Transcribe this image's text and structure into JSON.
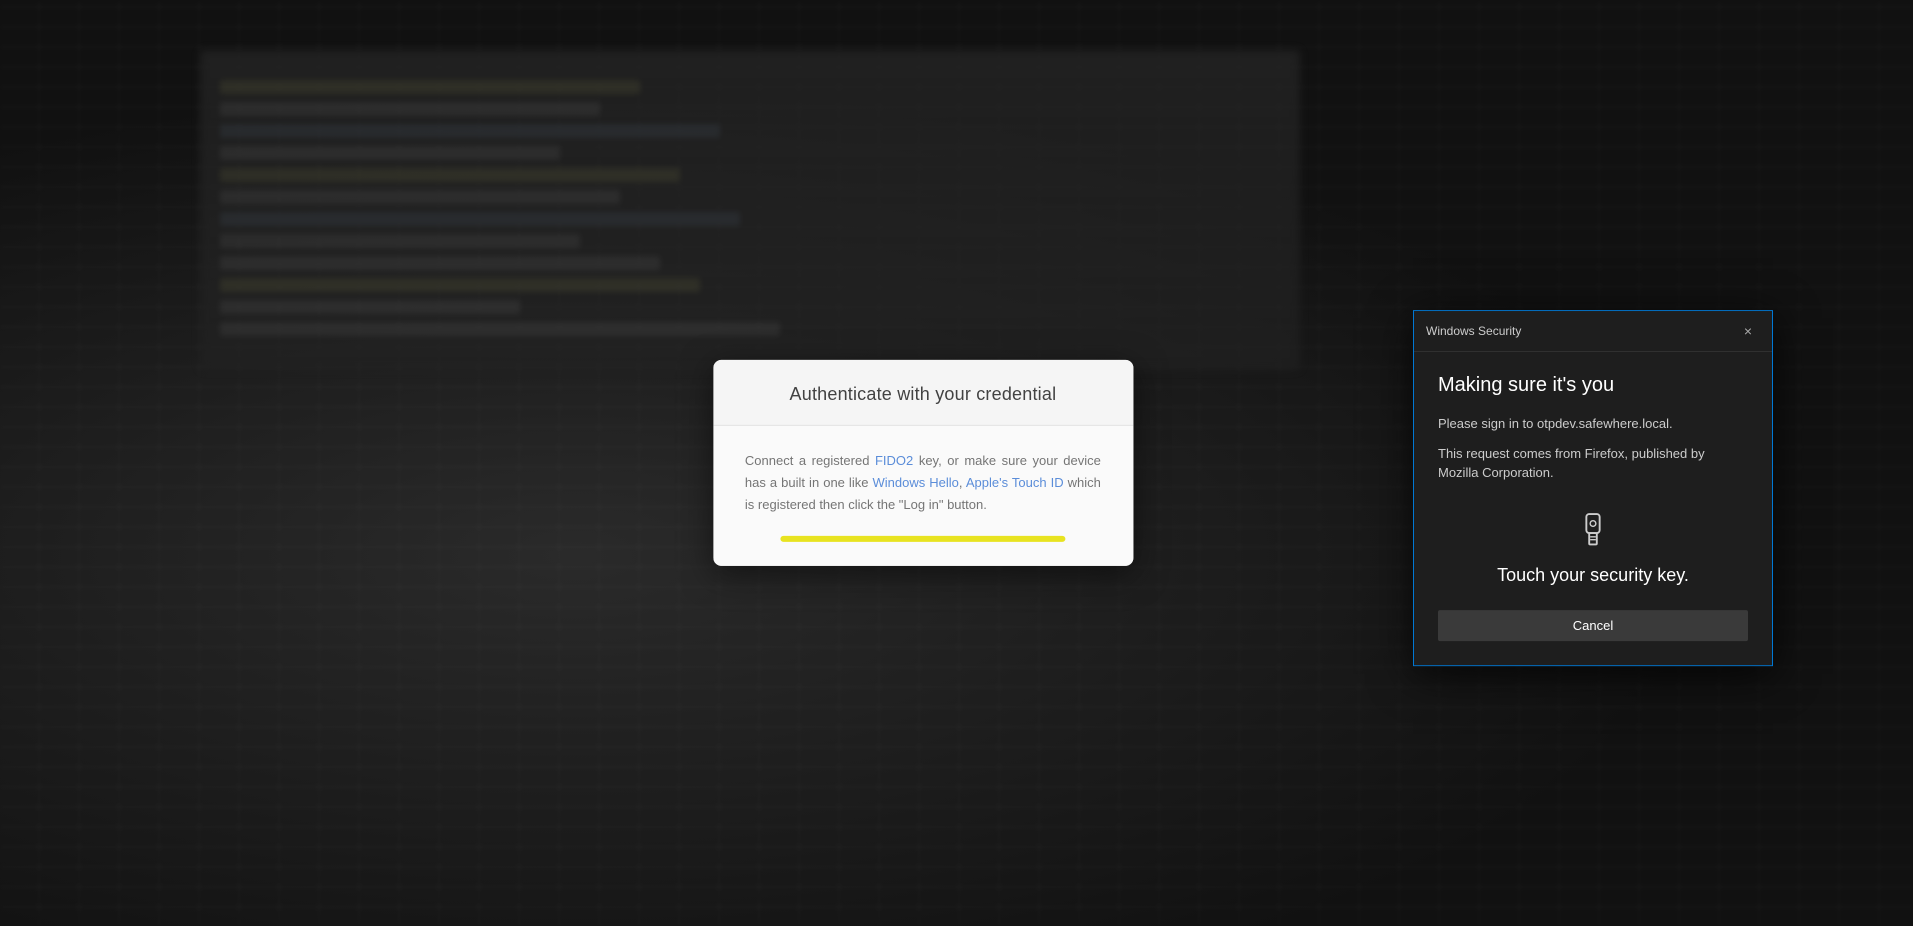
{
  "background": {
    "description": "Blurred laptop with code editor background"
  },
  "auth_dialog": {
    "title": "Authenticate with your credential",
    "body_text_before": "Connect a registered ",
    "fido2_highlight": "FIDO2",
    "body_text_middle1": " key, or make sure your device has a built in one like ",
    "windows_hello_highlight": "Windows Hello",
    "body_text_middle2": ", ",
    "apple_touch_highlight": "Apple's Touch ID",
    "body_text_after": " which is registered then click the \"Log in\" button."
  },
  "windows_security_dialog": {
    "titlebar_label": "Windows Security",
    "close_icon": "×",
    "heading": "Making sure it's you",
    "sign_in_label": "Please sign in to otpdev.safewhere.local.",
    "request_label": "This request comes from Firefox, published by Mozilla Corporation.",
    "key_icon_label": "security-key-icon",
    "touch_text": "Touch your security key.",
    "cancel_button_label": "Cancel"
  }
}
